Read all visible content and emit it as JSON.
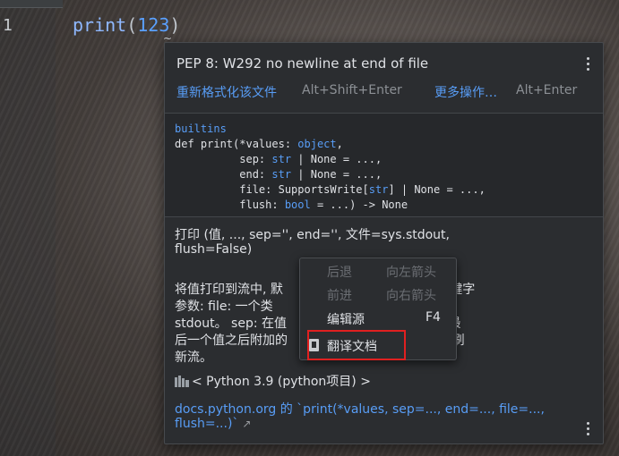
{
  "editor": {
    "line_number": "1",
    "code": {
      "fn": "print",
      "open": "(",
      "arg": "123",
      "close": ")"
    },
    "squiggle": "~"
  },
  "popup": {
    "warning": {
      "title": "PEP 8: W292 no newline at end of file",
      "quick_fix_label": "重新格式化该文件",
      "quick_fix_shortcut": "Alt+Shift+Enter",
      "more_actions_label": "更多操作…",
      "more_actions_shortcut": "Alt+Enter"
    },
    "signature": {
      "module": "builtins",
      "line1_prefix": "def print(*values: ",
      "line1_type": "object",
      "line1_suffix": ",",
      "line2_prefix": "          sep: ",
      "line2_type": "str",
      "line2_suffix": " | None = ...,",
      "line3_prefix": "          end: ",
      "line3_type": "str",
      "line3_suffix": " | None = ...,",
      "line4_prefix": "          file: SupportsWrite[",
      "line4_type": "str",
      "line4_suffix": "] | None = ...,",
      "line5_prefix": "          flush: ",
      "line5_type": "bool",
      "line5_suffix": " = ...) -> None"
    },
    "doc": {
      "summary_line1": "打印 (值, ..., sep='', end='', 文件=sys.stdout,",
      "summary_line2": "flush=False)",
      "body_line1": "将值打印到流中, 默                   dout。可选的关键字",
      "body_line2": "参数: file: 一个类                   认为当前的 sys.",
      "body_line3": "stdout。 sep: 在值                   空格。 end: 在最",
      "body_line4": "后一个值之后附加的                   flush: 是否强制刷",
      "body_line5": "新流。",
      "python_env": "< Python 3.9 (python项目) >",
      "docs_link_line1": "docs.python.org 的 `print(*values, sep=..., end=..., file=...,",
      "docs_link_line2": "flush=...)`",
      "external_icon": "↗"
    }
  },
  "context_menu": {
    "items": [
      {
        "label": "后退",
        "shortcut": "向左箭头"
      },
      {
        "label": "前进",
        "shortcut": "向右箭头"
      },
      {
        "label": "编辑源",
        "shortcut": "F4"
      },
      {
        "label": "翻译文档",
        "shortcut": ""
      }
    ]
  },
  "colors": {
    "link": "#589df6",
    "popup_bg": "#2b2d30",
    "highlight": "#e02020"
  }
}
